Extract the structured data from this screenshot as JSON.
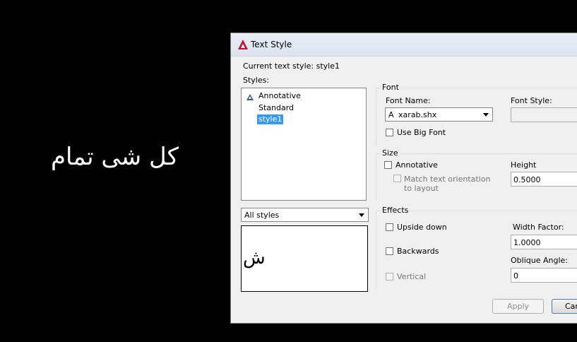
{
  "canvas": {
    "text": "كل شى تمام"
  },
  "dialog": {
    "title": "Text Style",
    "current_style_label": "Current text style:",
    "current_style_value": "style1",
    "styles_label": "Styles:",
    "styles": [
      {
        "name": "Annotative",
        "annotative": true,
        "selected": false
      },
      {
        "name": "Standard",
        "annotative": false,
        "selected": false
      },
      {
        "name": "style1",
        "annotative": false,
        "selected": true
      }
    ],
    "filter": {
      "value": "All styles"
    },
    "preview_glyph": "ش",
    "font": {
      "group_label": "Font",
      "font_name_label": "Font Name:",
      "font_name_value": "xarab.shx",
      "font_style_label": "Font Style:",
      "font_style_value": "",
      "use_big_font_label": "Use Big Font"
    },
    "size": {
      "group_label": "Size",
      "annotative_label": "Annotative",
      "match_label_line1": "Match text orientation",
      "match_label_line2": "to layout",
      "height_label": "Height",
      "height_value": "0.5000"
    },
    "effects": {
      "group_label": "Effects",
      "upside_down_label": "Upside down",
      "backwards_label": "Backwards",
      "vertical_label": "Vertical",
      "width_factor_label": "Width Factor:",
      "width_factor_value": "1.0000",
      "oblique_label": "Oblique Angle:",
      "oblique_value": "0"
    },
    "buttons": {
      "apply": "Apply",
      "cancel": "Can"
    }
  }
}
